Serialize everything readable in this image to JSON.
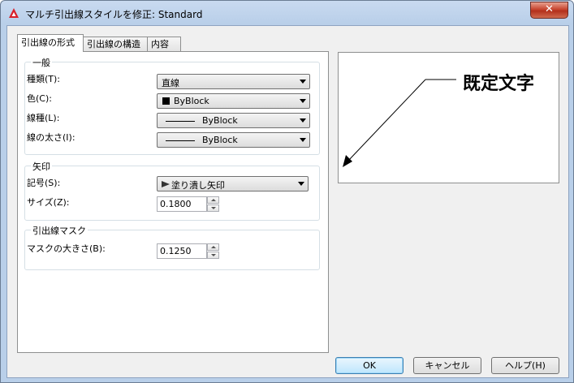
{
  "window": {
    "title": "マルチ引出線スタイルを修正: Standard",
    "close_label": "✕"
  },
  "tabs": [
    {
      "label": "引出線の形式",
      "active": true
    },
    {
      "label": "引出線の構造",
      "active": false
    },
    {
      "label": "内容",
      "active": false
    }
  ],
  "general": {
    "title": "一般",
    "type_label": "種類(T):",
    "type_value": "直線",
    "color_label": "色(C):",
    "color_value": "ByBlock",
    "linetype_label": "線種(L):",
    "linetype_value": "ByBlock",
    "lineweight_label": "線の太さ(I):",
    "lineweight_value": "ByBlock"
  },
  "arrowhead": {
    "title": "矢印",
    "symbol_label": "記号(S):",
    "symbol_value": "塗り潰し矢印",
    "size_label": "サイズ(Z):",
    "size_value": "0.1800"
  },
  "break": {
    "title": "引出線マスク",
    "size_label": "マスクの大きさ(B):",
    "size_value": "0.1250"
  },
  "preview": {
    "text": "既定文字"
  },
  "buttons": {
    "ok": "OK",
    "cancel": "キャンセル",
    "help": "ヘルプ(H)"
  },
  "colors": {
    "accent_blue": "#3c7fb1",
    "close_red": "#c7452f",
    "app_icon_red": "#d8202a"
  },
  "icons": {
    "app": "autocad-triangle-icon",
    "close": "close-icon",
    "dropdown": "chevron-down-icon",
    "arrow": "filled-arrow-icon"
  }
}
